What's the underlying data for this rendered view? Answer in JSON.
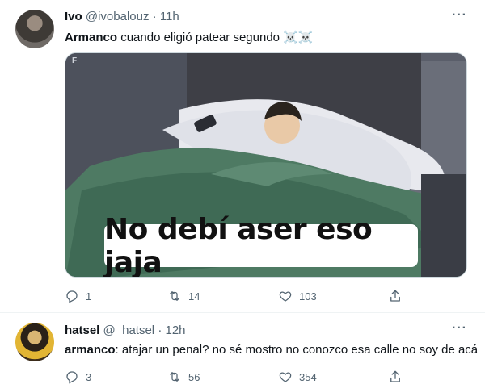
{
  "tweets": [
    {
      "name": "Ivo",
      "handle": "@ivobalouz",
      "sep": "·",
      "time": "11h",
      "more": "···",
      "mention": "Armanco",
      "text": " cuando eligió patear segundo ☠️☠️",
      "media": {
        "watermark": "F",
        "caption": "No debí aser eso jaja"
      },
      "actions": {
        "replies": "1",
        "retweets": "14",
        "likes": "103"
      }
    },
    {
      "name": "hatsel",
      "handle": "@_hatsel",
      "sep": "·",
      "time": "12h",
      "more": "···",
      "mention": "armanco",
      "text": ": atajar un penal? no sé mostro no conozco esa calle no soy de acá",
      "actions": {
        "replies": "3",
        "retweets": "56",
        "likes": "354"
      }
    }
  ],
  "icons": {
    "reply": "reply-icon",
    "retweet": "retweet-icon",
    "like": "heart-icon",
    "share": "share-icon"
  }
}
